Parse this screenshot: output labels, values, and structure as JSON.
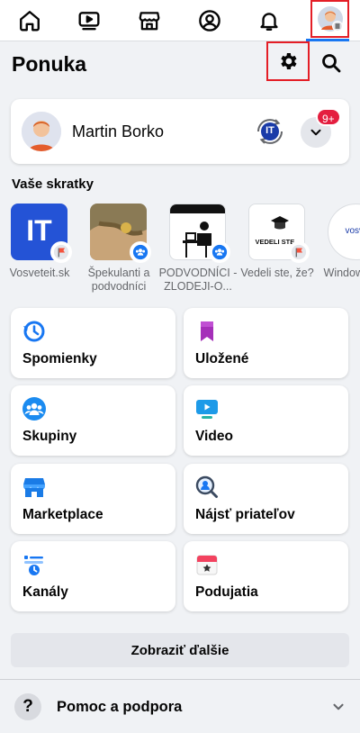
{
  "header": {
    "title": "Ponuka"
  },
  "profile": {
    "name": "Martin Borko",
    "switch_badge": "IT",
    "notification_count": "9+"
  },
  "shortcuts": {
    "title": "Vaše skratky",
    "items": [
      {
        "label": "Vosveteit.sk",
        "thumb_text": "IT"
      },
      {
        "label": "Špekulanti a podvodníci"
      },
      {
        "label": "PODVODNÍCI -ZLODEJI-O..."
      },
      {
        "label": "Vedeli ste, že?",
        "thumb_text": "VEDELI STE..."
      },
      {
        "label": "Window trum",
        "thumb_text": "vosve"
      }
    ]
  },
  "tiles": [
    {
      "label": "Spomienky",
      "icon": "clock-history-icon"
    },
    {
      "label": "Uložené",
      "icon": "bookmark-icon"
    },
    {
      "label": "Skupiny",
      "icon": "groups-icon"
    },
    {
      "label": "Video",
      "icon": "video-icon"
    },
    {
      "label": "Marketplace",
      "icon": "storefront-icon"
    },
    {
      "label": "Nájsť priateľov",
      "icon": "find-friends-icon"
    },
    {
      "label": "Kanály",
      "icon": "feeds-icon"
    },
    {
      "label": "Podujatia",
      "icon": "calendar-icon"
    }
  ],
  "see_more": "Zobraziť ďalšie",
  "help": {
    "label": "Pomoc a podpora",
    "icon_glyph": "?"
  },
  "colors": {
    "accent": "#1877f2",
    "highlight": "#e41e26",
    "badge": "#e41e3f"
  }
}
